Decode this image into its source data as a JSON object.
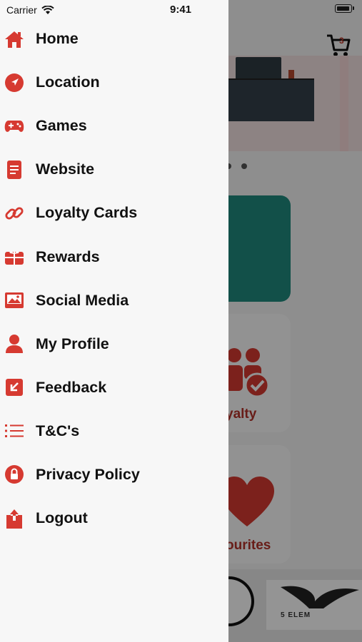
{
  "status_bar": {
    "carrier": "Carrier",
    "time": "9:41"
  },
  "menu": {
    "items": [
      {
        "label": "Home",
        "icon": "home-icon"
      },
      {
        "label": "Location",
        "icon": "location-arrow-icon"
      },
      {
        "label": "Games",
        "icon": "gamepad-icon"
      },
      {
        "label": "Website",
        "icon": "document-icon"
      },
      {
        "label": "Loyalty Cards",
        "icon": "link-icon"
      },
      {
        "label": "Rewards",
        "icon": "gift-icon"
      },
      {
        "label": "Social Media",
        "icon": "image-icon"
      },
      {
        "label": "My Profile",
        "icon": "user-icon"
      },
      {
        "label": "Feedback",
        "icon": "feedback-arrow-icon"
      },
      {
        "label": "T&C's",
        "icon": "list-icon"
      },
      {
        "label": "Privacy Policy",
        "icon": "lock-icon"
      },
      {
        "label": "Logout",
        "icon": "logout-icon"
      }
    ]
  },
  "background": {
    "cart_count": "3",
    "loyalty_label": "yalty",
    "favourites_label": "ourites",
    "logo_text": "5 ELEM"
  },
  "colors": {
    "accent": "#d63a31",
    "drawer_bg": "#f7f7f7",
    "teal": "#1f8a7f"
  }
}
